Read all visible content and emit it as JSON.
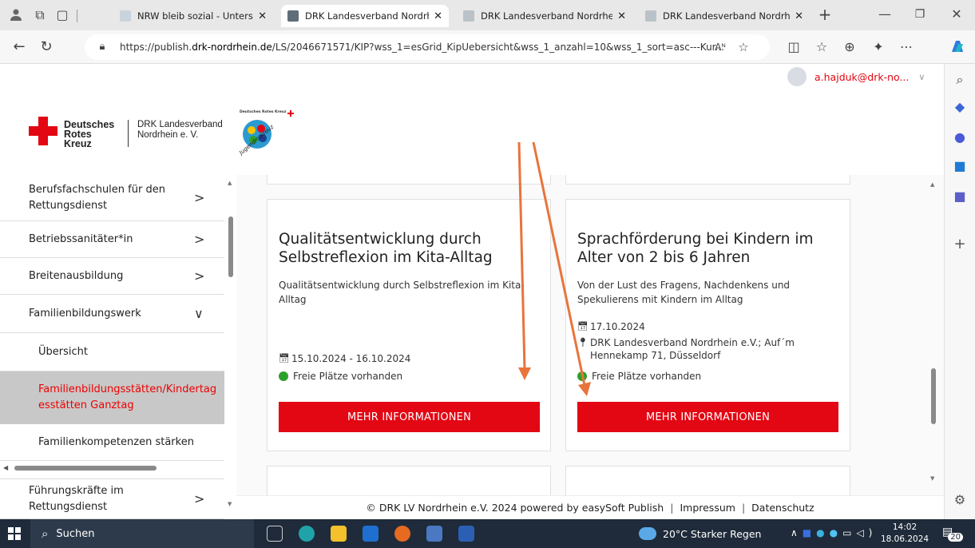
{
  "browser": {
    "tabs": [
      {
        "title": "NRW bleib sozial - Unterstützun",
        "active": false
      },
      {
        "title": "DRK Landesverband Nordrhein",
        "active": true
      },
      {
        "title": "DRK Landesverband Nordrhein",
        "active": false
      },
      {
        "title": "DRK Landesverband Nordrhein",
        "active": false
      }
    ],
    "url_prefix": "https://publish.",
    "url_domain": "drk-nordrhein.de",
    "url_rest": "/LS/2046671571/KIP?wss_1=esGrid_KipUebersicht&wss_1_anzahl=10&wss_1_sort=asc---Kur...",
    "reader_label": "Aᴺ"
  },
  "user": {
    "email": "a.hajduk@drk-no..."
  },
  "brand": {
    "logo_line1": "Deutsches",
    "logo_line2": "Rotes",
    "logo_line3": "Kreuz",
    "org_line1": "DRK Landesverband",
    "org_line2": "Nordrhein e. V.",
    "jrk_top": "Deutsches Rotes Kreuz",
    "jrk_text": "Jugendrotkreuz"
  },
  "sidebar": {
    "items": [
      {
        "label": "Berufsfachschulen für den Rettungsdienst",
        "chevron": ">"
      },
      {
        "label": "Betriebssanitäter*in",
        "chevron": ">"
      },
      {
        "label": "Breitenausbildung",
        "chevron": ">"
      },
      {
        "label": "Familienbildungswerk",
        "chevron": "∨"
      },
      {
        "label": "Übersicht"
      },
      {
        "label": "Familienbildungsstätten/Kindertagesstätten Ganztag"
      },
      {
        "label": "Familienkompetenzen stärken"
      },
      {
        "label": "Führungskräfte im Rettungsdienst",
        "chevron": ">"
      }
    ],
    "scroll_position": 0.18
  },
  "courses": [
    {
      "title": "Qualitätsentwicklung durch Selbstreflexion im Kita-Alltag",
      "description": "Qualitätsentwicklung durch Selbstreflexion im Kita-Alltag",
      "date": "15.10.2024 - 16.10.2024",
      "availability": "Freie Plätze vorhanden",
      "button": "MEHR INFORMATIONEN"
    },
    {
      "title": "Sprachförderung bei Kindern im Alter von 2 bis 6 Jahren",
      "description": "Von der Lust des Fragens, Nachdenkens und Spekulierens mit Kindern im Alltag",
      "date": "17.10.2024",
      "location": "DRK Landesverband Nordrhein e.V.; Auf´m Hennekamp 71, Düsseldorf",
      "availability": "Freie Plätze vorhanden",
      "button": "MEHR INFORMATIONEN"
    }
  ],
  "footer": {
    "copyright": "© DRK LV Nordrhein e.V. 2024 powered by easySoft Publish",
    "impressum": "Impressum",
    "datenschutz": "Datenschutz"
  },
  "taskbar": {
    "search": "Suchen",
    "weather": "20°C  Starker Regen",
    "time": "14:02",
    "date": "18.06.2024",
    "notifications": "20"
  },
  "colors": {
    "drk_red": "#e30613",
    "available_green": "#2ca02c",
    "arrow": "#e8743b"
  }
}
